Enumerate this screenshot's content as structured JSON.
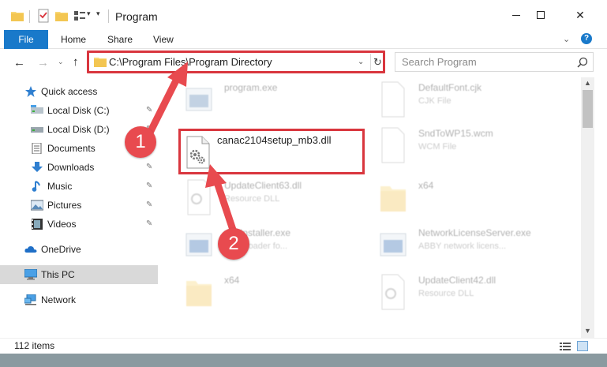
{
  "window": {
    "title": "Program",
    "controls": {
      "minimize": "—",
      "maximize": "☐",
      "close": "✕"
    }
  },
  "quick_access_toolbar": {
    "dropdown_glyph": "▾"
  },
  "ribbon": {
    "tabs": [
      "File",
      "Home",
      "Share",
      "View"
    ],
    "collapse_glyph": "⌄",
    "help_label": "?"
  },
  "navigation": {
    "back_glyph": "←",
    "forward_glyph": "→",
    "history_glyph": "⌄",
    "up_glyph": "↑",
    "address": "C:\\Program Files\\Program Directory",
    "address_dropdown_glyph": "⌄",
    "refresh_glyph": "↻",
    "search_placeholder": "Search Program"
  },
  "sidebar": {
    "items": [
      {
        "label": "Quick access",
        "icon": "star-icon",
        "pinned": false
      },
      {
        "label": "Local Disk (C:)",
        "icon": "drive-icon",
        "pinned": true
      },
      {
        "label": "Local Disk (D:)",
        "icon": "drive-icon",
        "pinned": true
      },
      {
        "label": "Documents",
        "icon": "documents-icon",
        "pinned": true
      },
      {
        "label": "Downloads",
        "icon": "download-icon",
        "pinned": true
      },
      {
        "label": "Music",
        "icon": "music-icon",
        "pinned": true
      },
      {
        "label": "Pictures",
        "icon": "pictures-icon",
        "pinned": true
      },
      {
        "label": "Videos",
        "icon": "videos-icon",
        "pinned": true
      },
      {
        "label": "OneDrive",
        "icon": "cloud-icon",
        "pinned": false
      },
      {
        "label": "This PC",
        "icon": "computer-icon",
        "pinned": false,
        "selected": true
      },
      {
        "label": "Network",
        "icon": "network-icon",
        "pinned": false
      }
    ],
    "pin_glyph": "📌"
  },
  "files": [
    {
      "name": "program.exe",
      "type": ""
    },
    {
      "name": "DefaultFont.cjk",
      "type": "CJK File"
    },
    {
      "name": "SndToWP15.wcm",
      "type": "WCM File"
    },
    {
      "name": "UpdateClient63.dll",
      "type": "Resource DLL"
    },
    {
      "name": "x64",
      "type": ""
    },
    {
      "name": "mmInstaller.exe",
      "type": "Downloader fo..."
    },
    {
      "name": "NetworkLicenseServer.exe",
      "type": "ABBY network licens..."
    },
    {
      "name": "x64",
      "type": ""
    },
    {
      "name": "UpdateClient42.dll",
      "type": "Resource DLL"
    }
  ],
  "highlighted_file": {
    "name": "canac2104setup_mb3.dll"
  },
  "annotations": {
    "step1": "1",
    "step2": "2",
    "color": "#e84a4f"
  },
  "status": {
    "item_count": "112 items"
  },
  "colors": {
    "accent": "#1979ca",
    "highlight": "#d9363e"
  }
}
